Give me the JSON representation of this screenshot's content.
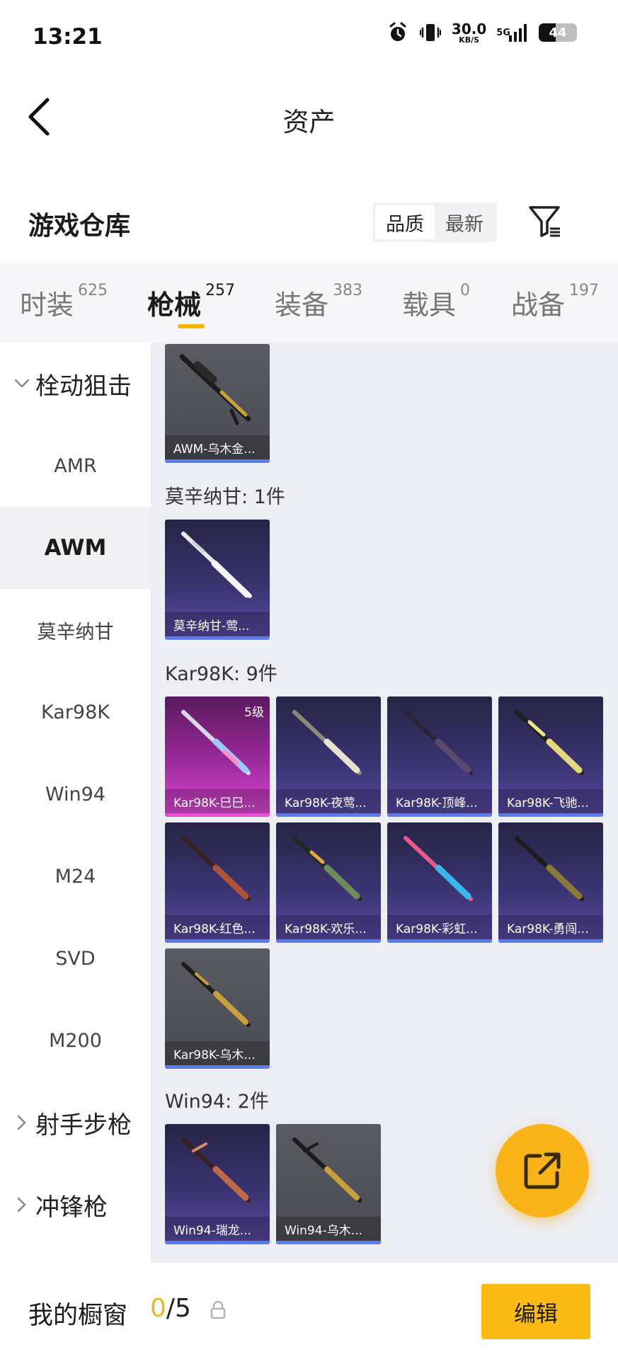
{
  "status_bar": {
    "time": "13:21",
    "net_speed_value": "30.0",
    "net_speed_unit": "KB/S",
    "network_type": "5G",
    "battery_level": "44"
  },
  "header": {
    "title": "资产"
  },
  "section": {
    "title": "游戏仓库",
    "sort_options": [
      "品质",
      "最新"
    ],
    "active_sort": "品质"
  },
  "category_tabs": [
    {
      "label": "时装",
      "count": "625"
    },
    {
      "label": "枪械",
      "count": "257",
      "active": true
    },
    {
      "label": "装备",
      "count": "383"
    },
    {
      "label": "载具",
      "count": "0"
    },
    {
      "label": "战备",
      "count": "197"
    }
  ],
  "sidebar": {
    "group_expanded": "栓动狙击",
    "items": [
      "AMR",
      "AWM",
      "莫辛纳甘",
      "Kar98K",
      "Win94",
      "M24",
      "SVD",
      "M200"
    ],
    "active_item": "AWM",
    "collapsed_groups": [
      "射手步枪",
      "冲锋枪"
    ]
  },
  "groups": [
    {
      "label": "",
      "items": [
        {
          "name": "AWM-乌木金...",
          "rarity": "grey"
        }
      ]
    },
    {
      "label": "莫辛纳甘: 1件",
      "items": [
        {
          "name": "莫辛纳甘-莺...",
          "rarity": "purple"
        }
      ]
    },
    {
      "label": "Kar98K: 9件",
      "items": [
        {
          "name": "Kar98K-巳巳...",
          "rarity": "pink",
          "level": "5级"
        },
        {
          "name": "Kar98K-夜莺...",
          "rarity": "purple"
        },
        {
          "name": "Kar98K-顶峰...",
          "rarity": "purple"
        },
        {
          "name": "Kar98K-飞驰...",
          "rarity": "purple"
        },
        {
          "name": "Kar98K-红色...",
          "rarity": "purple"
        },
        {
          "name": "Kar98K-欢乐...",
          "rarity": "purple"
        },
        {
          "name": "Kar98K-彩虹...",
          "rarity": "purple"
        },
        {
          "name": "Kar98K-勇闯...",
          "rarity": "purple"
        },
        {
          "name": "Kar98K-乌木...",
          "rarity": "grey"
        }
      ]
    },
    {
      "label": "Win94: 2件",
      "items": [
        {
          "name": "Win94-瑞龙...",
          "rarity": "purple"
        },
        {
          "name": "Win94-乌木...",
          "rarity": "grey"
        }
      ]
    }
  ],
  "bottom_bar": {
    "label": "我的橱窗",
    "current": "0",
    "separator_total": "/5",
    "edit_label": "编辑"
  },
  "colors": {
    "accent": "#f7b400",
    "rarity_grey": "#4f5057",
    "rarity_purple": "#3a3370",
    "rarity_pink": "#c23ac0",
    "card_bar": "#5b7cf0"
  },
  "icons": {
    "fab": "share-external-icon",
    "filter": "filter-icon",
    "back": "back-arrow-icon",
    "lock": "lock-icon"
  }
}
